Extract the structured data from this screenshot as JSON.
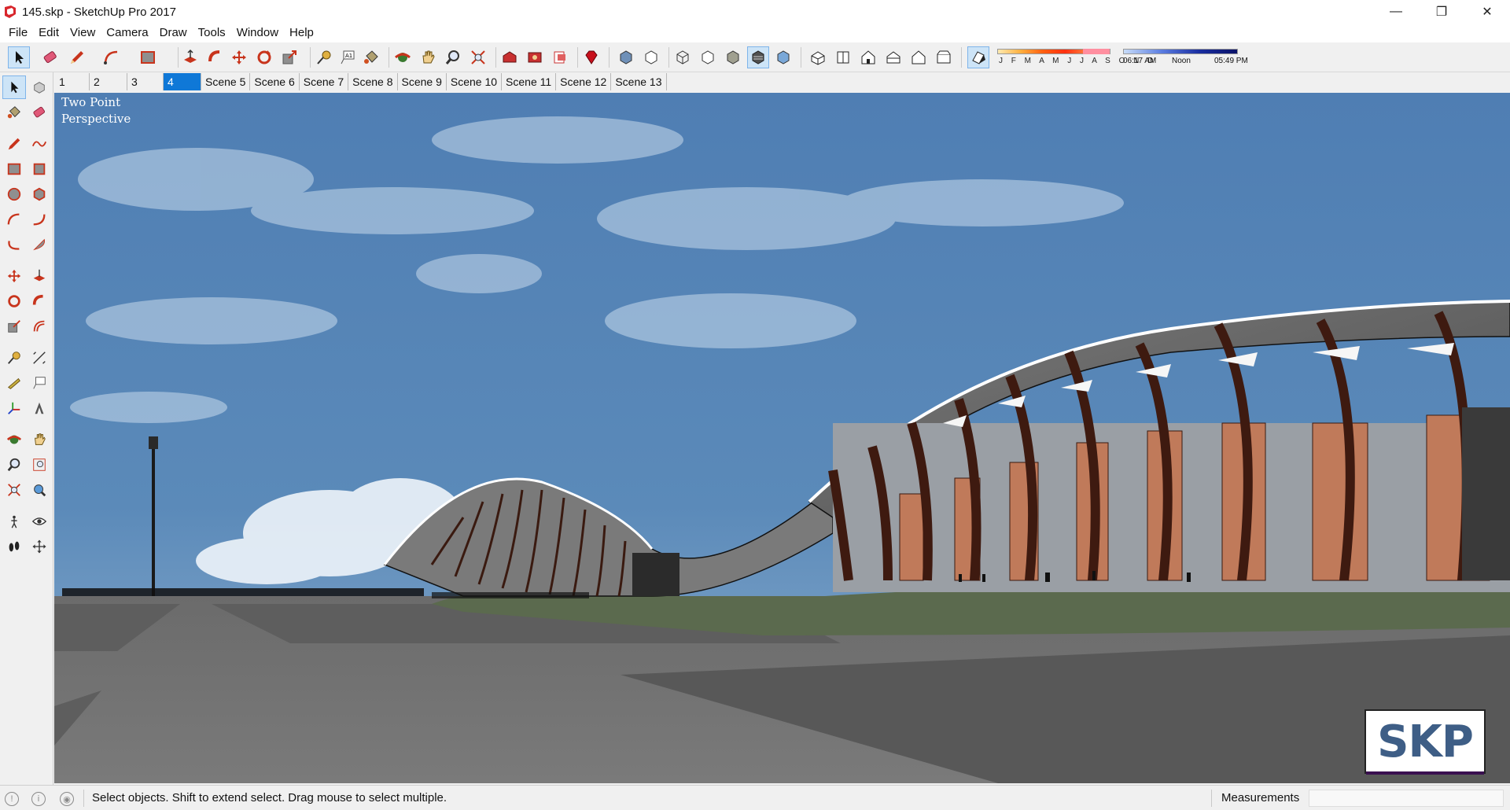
{
  "window": {
    "title": "145.skp - SketchUp Pro 2017",
    "minimize_glyph": "—",
    "restore_glyph": "❐",
    "close_glyph": "✕"
  },
  "menu": [
    "File",
    "Edit",
    "View",
    "Camera",
    "Draw",
    "Tools",
    "Window",
    "Help"
  ],
  "shadows": {
    "months": "J F M A M J J A S O N D",
    "time_start": "06:17 AM",
    "time_noon": "Noon",
    "time_end": "05:49 PM",
    "month_gradient_colors": [
      "#ffe9b0",
      "#ff6010"
    ],
    "time_gradient_colors": [
      "#c8dcf8",
      "#0a1268"
    ]
  },
  "scenes": {
    "tabs": [
      "1",
      "2",
      "3",
      "4",
      "Scene 5",
      "Scene 6",
      "Scene 7",
      "Scene 8",
      "Scene 9",
      "Scene 10",
      "Scene 11",
      "Scene 12",
      "Scene 13"
    ],
    "selected_index": 3
  },
  "viewport": {
    "camera_label_line1": "Two Point",
    "camera_label_line2": "Perspective",
    "watermark": "SKP",
    "sky_color": "#5a86b8",
    "ground_color": "#737373"
  },
  "status": {
    "message": "Select objects. Shift to extend select. Drag mouse to select multiple.",
    "measurements_label": "Measurements",
    "measurements_value": ""
  },
  "toolbar_icons": [
    "select-icon",
    "eraser-icon",
    "pencil-icon",
    "arc-icon",
    "rectangle-icon",
    "push-pull-icon",
    "follow-me-icon",
    "move-icon",
    "rotate-icon",
    "scale-icon",
    "tape-measure-icon",
    "text-icon",
    "paint-bucket-icon",
    "orbit-icon",
    "pan-icon",
    "zoom-icon",
    "zoom-extents-icon",
    "warehouse-icon",
    "extension-warehouse-icon",
    "layout-icon",
    "ruby-icon",
    "xray-icon",
    "back-edges-icon",
    "wireframe-icon",
    "hidden-line-icon",
    "shaded-icon",
    "shaded-textures-icon",
    "monochrome-icon",
    "iso-view-icon",
    "top-view-icon",
    "front-view-icon",
    "right-view-icon",
    "back-view-icon",
    "left-view-icon",
    "shadows-toggle-icon"
  ]
}
